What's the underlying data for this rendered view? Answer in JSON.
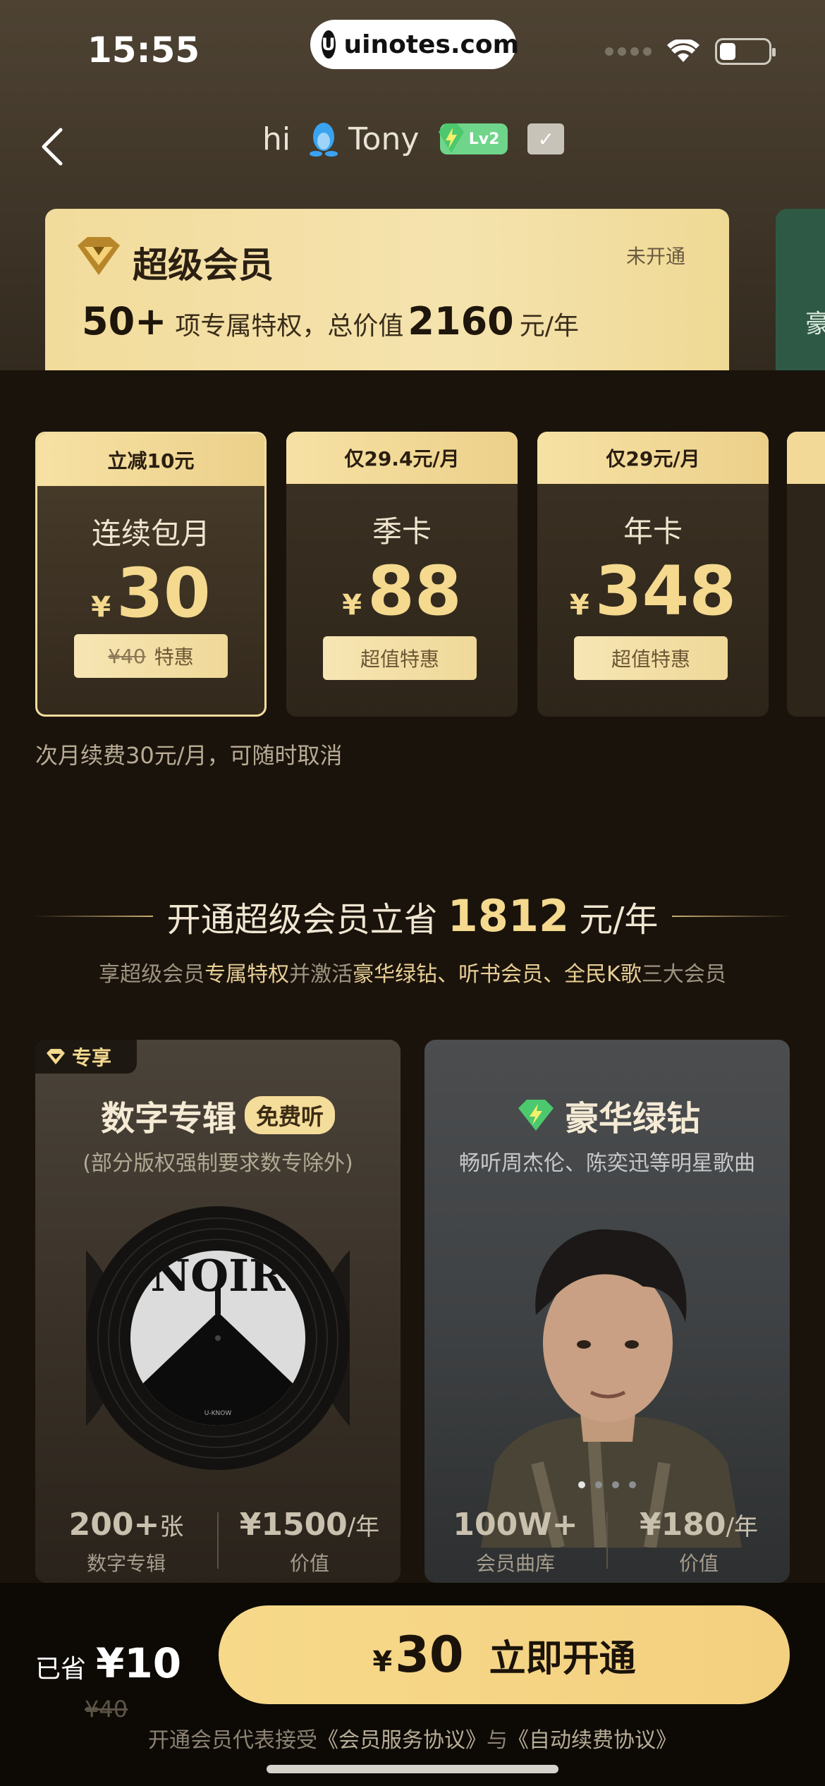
{
  "status_bar": {
    "time": "15:55",
    "url": "uinotes.com"
  },
  "header": {
    "greeting": "hi",
    "username": "Tony",
    "level": "Lv2"
  },
  "member_card": {
    "title": "超级会员",
    "status": "未开通",
    "count": "50+",
    "desc_mid": "项专属特权，总价值",
    "value": "2160",
    "unit": "元/年",
    "next_card_label": "豪"
  },
  "plans": [
    {
      "tag": "立减10元",
      "name": "连续包月",
      "currency": "¥",
      "price": "30",
      "orig": "¥40",
      "btn": "特惠",
      "selected": true
    },
    {
      "tag": "仅29.4元/月",
      "name": "季卡",
      "currency": "¥",
      "price": "88",
      "btn": "超值特惠",
      "selected": false
    },
    {
      "tag": "仅29元/月",
      "name": "年卡",
      "currency": "¥",
      "price": "348",
      "btn": "超值特惠",
      "selected": false
    }
  ],
  "renew_note": "次月续费30元/月，可随时取消",
  "section": {
    "title_pre": "开通超级会员立省",
    "amount": "1812",
    "title_post": "元/年",
    "sub_1": "享超级会员",
    "sub_hl1": "专属特权",
    "sub_2": "并激活",
    "sub_hl2": "豪华绿钻、听书会员、全民K歌",
    "sub_3": "三大会员"
  },
  "features": [
    {
      "badge": "专享",
      "title": "数字专辑",
      "pill": "免费听",
      "sub": "(部分版权强制要求数专除外)",
      "album_text": "NOIR",
      "album_sub": "U-KNOW",
      "stat1_value": "200+",
      "stat1_unit": "张",
      "stat1_label": "数字专辑",
      "stat2_value": "¥1500",
      "stat2_unit": "/年",
      "stat2_label": "价值"
    },
    {
      "title": "豪华绿钻",
      "sub": "畅听周杰伦、陈奕迅等明星歌曲",
      "stat1_value": "100W+",
      "stat1_unit": "",
      "stat1_label": "会员曲库",
      "stat2_value": "¥180",
      "stat2_unit": "/年",
      "stat2_label": "价值"
    }
  ],
  "bottom": {
    "saved_label": "已省",
    "saved_amount": "¥10",
    "orig_price": "¥40",
    "cta_currency": "¥",
    "cta_amount": "30",
    "cta_label": "立即开通",
    "agree_pre": "开通会员代表接受",
    "agree_link1": "《会员服务协议》",
    "agree_mid": "与",
    "agree_link2": "《自动续费协议》"
  },
  "colors": {
    "gold": "#f4d98e",
    "bg": "#1a130b",
    "card": "#f2dc9c",
    "green": "#2e5a45"
  }
}
